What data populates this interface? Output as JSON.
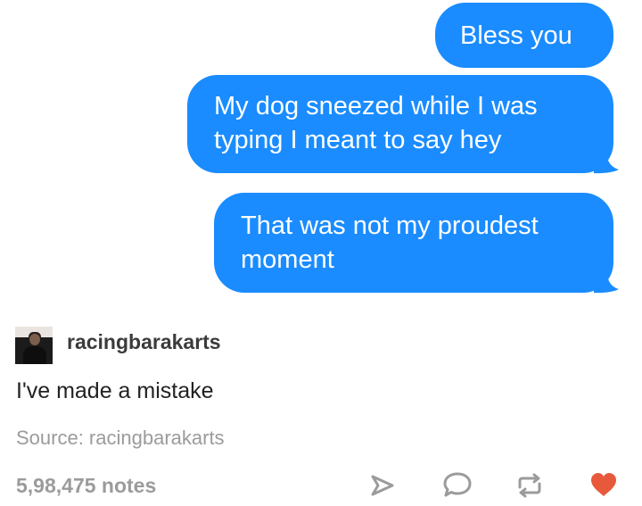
{
  "messages": [
    {
      "lines": [
        "Bless you"
      ]
    },
    {
      "lines": [
        "My dog sneezed while I was",
        "typing I meant to say hey"
      ]
    },
    {
      "lines": [
        "That was not my proudest",
        "moment"
      ]
    }
  ],
  "post": {
    "username": "racingbarakarts",
    "caption": "I've made a mistake",
    "source": "Source: racingbarakarts",
    "notes": "5,98,475 notes"
  },
  "actions": [
    "share-icon",
    "reply-icon",
    "reblog-icon",
    "like-icon"
  ],
  "colors": {
    "bubble": "#1a8cff",
    "like": "#e8593c",
    "icon": "#9b9b9b"
  }
}
